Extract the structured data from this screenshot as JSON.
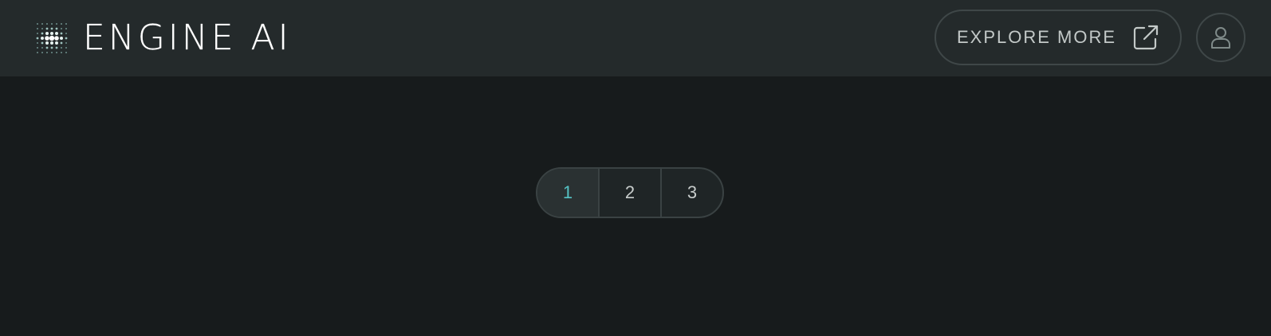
{
  "header": {
    "logo_text": "ENGINE AI",
    "logo_icon": "dot-grid-logo-icon",
    "explore_label": "EXPLORE MORE",
    "explore_icon": "external-link-icon",
    "user_icon": "user-icon"
  },
  "pagination": {
    "pages": [
      "1",
      "2",
      "3"
    ],
    "active_page": "1"
  },
  "colors": {
    "background": "#171b1c",
    "header_background": "#242a2b",
    "accent": "#55c2c4",
    "border": "#3f4748",
    "text": "#c3c9c8"
  }
}
